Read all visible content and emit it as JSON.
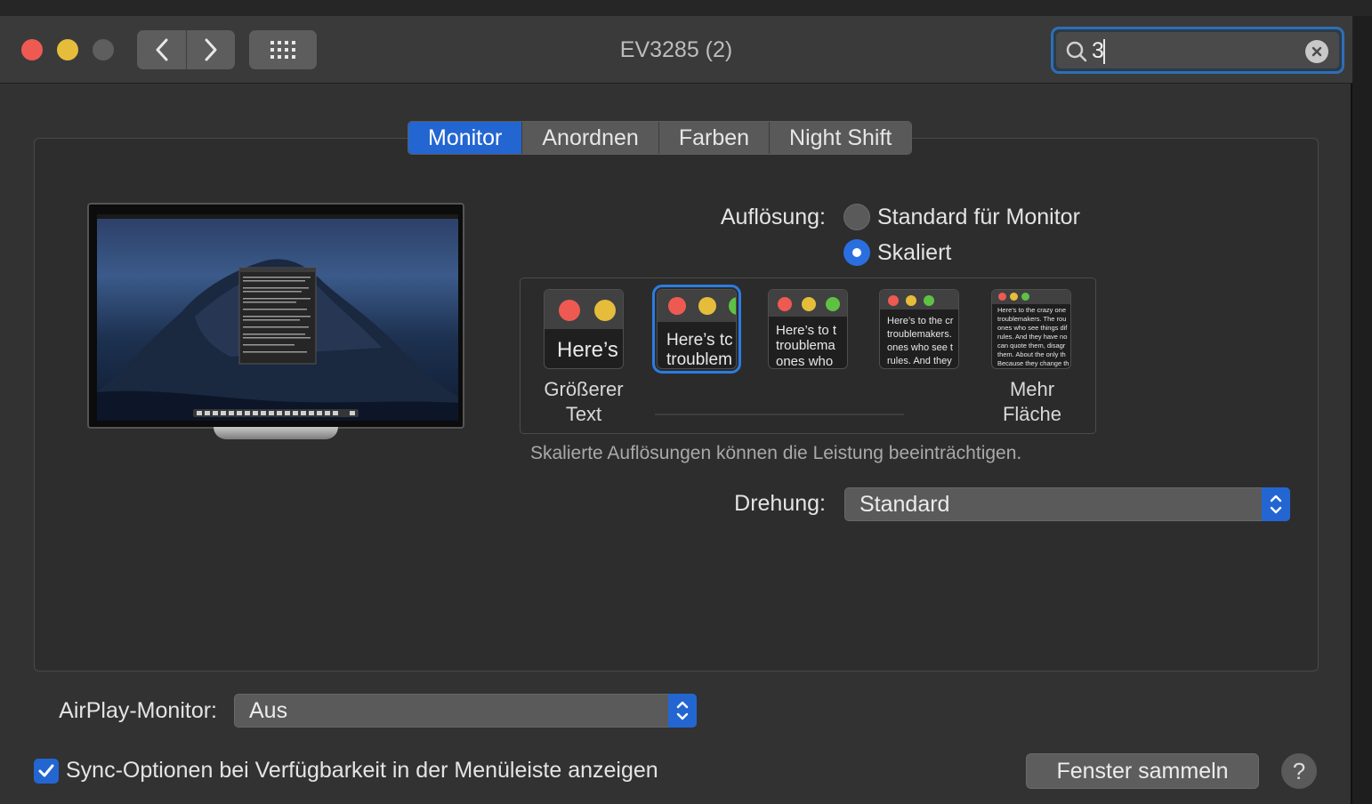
{
  "window": {
    "title": "EV3285 (2)"
  },
  "colors": {
    "close": "#ee5a52",
    "minimize": "#e5bd3a",
    "zoom_disabled": "#5e5e5e",
    "accent": "#2366d1"
  },
  "search": {
    "value": "3"
  },
  "tabs": [
    {
      "label": "Monitor",
      "active": true
    },
    {
      "label": "Anordnen",
      "active": false
    },
    {
      "label": "Farben",
      "active": false
    },
    {
      "label": "Night Shift",
      "active": false
    }
  ],
  "resolution": {
    "label": "Auflösung:",
    "options": [
      {
        "label": "Standard für Monitor",
        "selected": false
      },
      {
        "label": "Skaliert",
        "selected": true
      }
    ]
  },
  "scaling": {
    "left_caption_line1": "Größerer",
    "left_caption_line2": "Text",
    "right_caption_line1": "Mehr",
    "right_caption_line2": "Fläche",
    "thumbs": [
      {
        "text": "Here’s",
        "selected": false
      },
      {
        "text": "Here’s tc\ntroublem",
        "selected": true
      },
      {
        "text": "Here’s to t\ntroublema\nones who",
        "selected": false
      },
      {
        "text": "Here’s to the cr\ntroublemakers.\nones who see t\nrules. And they",
        "selected": false
      },
      {
        "text": "Here’s to the crazy one\ntroublemakers. The rou\nones who see things dif\nrules. And they have no\ncan quote them, disagr\nthem. About the only th\nBecause they change th",
        "selected": false
      }
    ],
    "note": "Skalierte Auflösungen können die Leistung beeinträchtigen."
  },
  "rotation": {
    "label": "Drehung:",
    "value": "Standard"
  },
  "airplay": {
    "label": "AirPlay-Monitor:",
    "value": "Aus"
  },
  "sync": {
    "label": "Sync-Optionen bei Verfügbarkeit in der Menüleiste anzeigen",
    "checked": true
  },
  "gather_button": "Fenster sammeln",
  "help": "?"
}
